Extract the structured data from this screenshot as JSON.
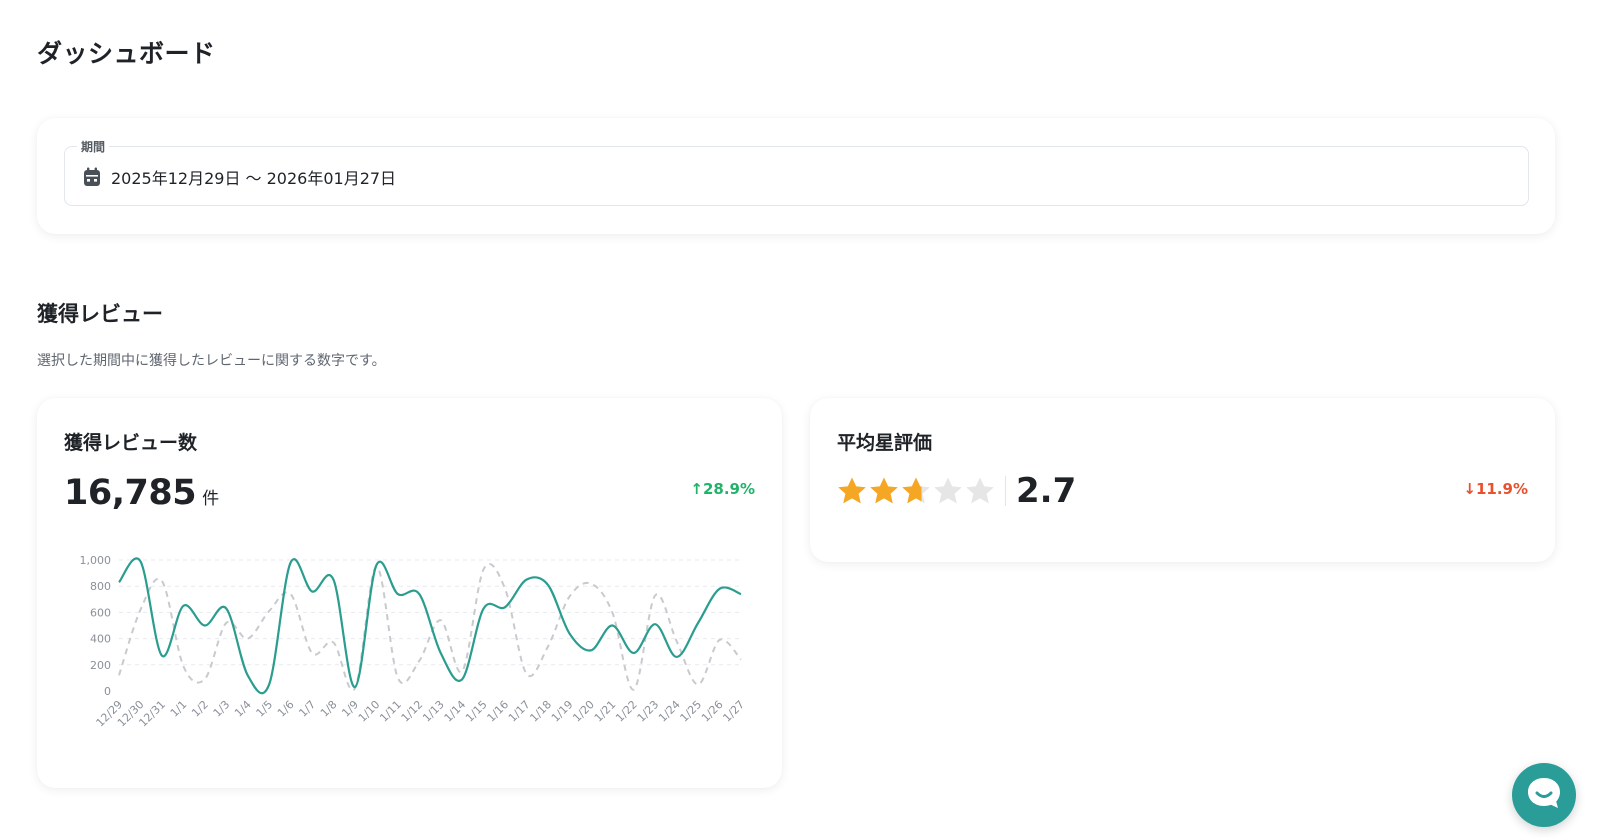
{
  "page": {
    "title": "ダッシュボード"
  },
  "period": {
    "label": "期間",
    "value": "2025年12月29日 〜 2026年01月27日",
    "icon": "calendar-icon"
  },
  "reviews_section": {
    "title": "獲得レビュー",
    "description": "選択した期間中に獲得したレビューに関する数字です。"
  },
  "review_count_card": {
    "title": "獲得レビュー数",
    "value": "16,785",
    "unit": "件",
    "delta": "↑28.9%",
    "delta_color": "#22b36a"
  },
  "rating_card": {
    "title": "平均星評価",
    "value": "2.7",
    "rating": 2.7,
    "max_stars": 5,
    "star_color": "#f5a623",
    "star_empty_color": "#e6e6e6",
    "delta": "↓11.9%",
    "delta_color": "#e8512d"
  },
  "chart_data": {
    "type": "line",
    "categories": [
      "12/29",
      "12/30",
      "12/31",
      "1/1",
      "1/2",
      "1/3",
      "1/4",
      "1/5",
      "1/6",
      "1/7",
      "1/8",
      "1/9",
      "1/10",
      "1/11",
      "1/12",
      "1/13",
      "1/14",
      "1/15",
      "1/16",
      "1/17",
      "1/18",
      "1/19",
      "1/20",
      "1/21",
      "1/22",
      "1/23",
      "1/24",
      "1/25",
      "1/26",
      "1/27"
    ],
    "y_ticks": [
      "0",
      "200",
      "400",
      "600",
      "800",
      "1,000"
    ],
    "ylim": [
      0,
      1000
    ],
    "grid": true,
    "series": [
      {
        "style": "solid",
        "color": "#2a9d8f",
        "values": [
          830,
          990,
          270,
          650,
          500,
          630,
          120,
          50,
          980,
          760,
          850,
          30,
          960,
          740,
          740,
          290,
          90,
          630,
          640,
          850,
          810,
          440,
          310,
          500,
          290,
          510,
          260,
          520,
          780,
          740
        ]
      },
      {
        "style": "dashed",
        "color": "#c8cacd",
        "values": [
          120,
          620,
          840,
          190,
          90,
          520,
          400,
          610,
          740,
          290,
          370,
          20,
          950,
          100,
          230,
          540,
          150,
          930,
          780,
          130,
          340,
          720,
          820,
          600,
          10,
          730,
          380,
          50,
          390,
          240
        ]
      }
    ]
  },
  "chat": {
    "icon": "chat-bubble-icon"
  }
}
